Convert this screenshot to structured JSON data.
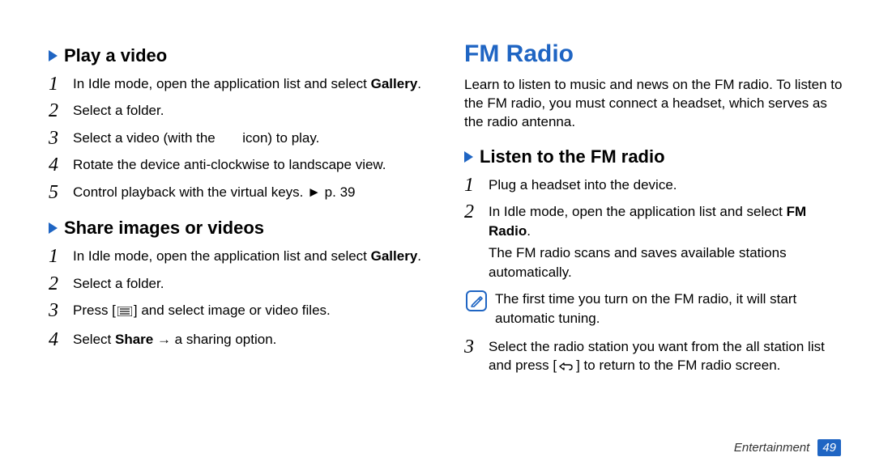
{
  "left": {
    "sec1": {
      "heading": "Play a video",
      "steps": [
        {
          "pre": "In Idle mode, open the application list and select ",
          "bold": "Gallery",
          "post": "."
        },
        {
          "text": "Select a folder."
        },
        {
          "pre": "Select a video (with the ",
          "post": " icon) to play."
        },
        {
          "text": "Rotate the device anti-clockwise to landscape view."
        },
        {
          "text": "Control playback with the virtual keys. ► p. 39"
        }
      ]
    },
    "sec2": {
      "heading": "Share images or videos",
      "steps": [
        {
          "pre": "In Idle mode, open the application list and select ",
          "bold": "Gallery",
          "post": "."
        },
        {
          "text": "Select a folder."
        },
        {
          "pre": "Press [",
          "post": "] and select image or video files.",
          "glyph": "menu"
        },
        {
          "pre": "Select ",
          "bold": "Share",
          "post": " → a sharing option."
        }
      ]
    }
  },
  "right": {
    "title": "FM Radio",
    "intro": "Learn to listen to music and news on the FM radio. To listen to the FM radio, you must connect a headset, which serves as the radio antenna.",
    "sec1": {
      "heading": "Listen to the FM radio",
      "step1": "Plug a headset into the device.",
      "step2_pre": "In Idle mode, open the application list and select ",
      "step2_bold": "FM Radio",
      "step2_post": ".",
      "step2_sub": "The FM radio scans and saves available stations automatically.",
      "note": "The first time you turn on the FM radio, it will start automatic tuning.",
      "step3_pre": "Select the radio station you want from the all station list and press [",
      "step3_post": "] to return to the FM radio screen."
    }
  },
  "footer": {
    "section": "Entertainment",
    "page": "49"
  }
}
